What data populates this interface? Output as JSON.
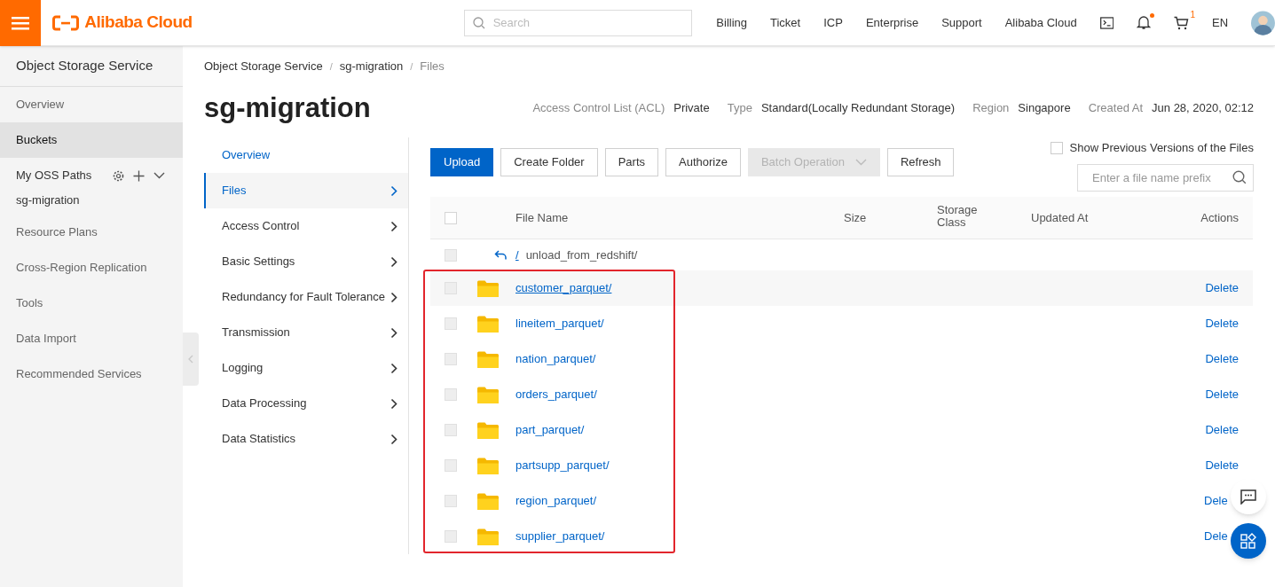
{
  "header": {
    "brand": "Alibaba Cloud",
    "search_placeholder": "Search",
    "nav": [
      "Billing",
      "Ticket",
      "ICP",
      "Enterprise",
      "Support",
      "Alibaba Cloud"
    ],
    "notification_dot": true,
    "cart_count": "1",
    "language": "EN"
  },
  "sidebar": {
    "title": "Object Storage Service",
    "items": [
      {
        "label": "Overview",
        "kind": "link",
        "selected": false
      },
      {
        "label": "Buckets",
        "kind": "link",
        "selected": true
      },
      {
        "label": "My OSS Paths",
        "kind": "section",
        "selected": false
      },
      {
        "label": "sg-migration",
        "kind": "path",
        "selected": false
      },
      {
        "label": "Resource Plans",
        "kind": "link",
        "selected": false
      },
      {
        "label": "Cross-Region Replication",
        "kind": "link",
        "selected": false
      },
      {
        "label": "Tools",
        "kind": "link",
        "selected": false
      },
      {
        "label": "Data Import",
        "kind": "link",
        "selected": false
      },
      {
        "label": "Recommended Services",
        "kind": "link",
        "selected": false
      }
    ]
  },
  "breadcrumb": [
    {
      "label": "Object Storage Service",
      "separator": "/"
    },
    {
      "label": "sg-migration",
      "separator": "/"
    },
    {
      "label": "Files"
    }
  ],
  "bucket": {
    "title": "sg-migration",
    "info": [
      {
        "label": "Access Control List (ACL)",
        "value": "Private"
      },
      {
        "label": "Type",
        "value": "Standard(Locally Redundant Storage)"
      },
      {
        "label": "Region",
        "value": "Singapore"
      },
      {
        "label": "Created At",
        "value": "Jun 28, 2020, 02:12"
      }
    ]
  },
  "bucket_menu": [
    {
      "label": "Overview",
      "kind": "link",
      "selected": false
    },
    {
      "label": "Files",
      "kind": "submenu",
      "selected": true
    },
    {
      "label": "Access Control",
      "kind": "submenu",
      "selected": false
    },
    {
      "label": "Basic Settings",
      "kind": "submenu",
      "selected": false
    },
    {
      "label": "Redundancy for Fault Tolerance",
      "kind": "submenu",
      "selected": false
    },
    {
      "label": "Transmission",
      "kind": "submenu",
      "selected": false
    },
    {
      "label": "Logging",
      "kind": "submenu",
      "selected": false
    },
    {
      "label": "Data Processing",
      "kind": "submenu",
      "selected": false
    },
    {
      "label": "Data Statistics",
      "kind": "submenu",
      "selected": false
    }
  ],
  "toolbar": {
    "buttons": [
      {
        "label": "Upload",
        "kind": "primary",
        "disabled": false
      },
      {
        "label": "Create Folder",
        "kind": "default",
        "disabled": false
      },
      {
        "label": "Parts",
        "kind": "default",
        "disabled": false
      },
      {
        "label": "Authorize",
        "kind": "default",
        "disabled": false
      },
      {
        "label": "Batch Operation",
        "kind": "dropdown",
        "disabled": true
      },
      {
        "label": "Refresh",
        "kind": "default",
        "disabled": false
      }
    ],
    "versions_checkbox": {
      "label": "Show Previous Versions of the Files",
      "checked": false
    },
    "filter": {
      "placeholder": "Enter a file name prefix"
    }
  },
  "table": {
    "select_all_checked": false,
    "columns": [
      "File Name",
      "Size",
      "Storage Class",
      "Updated At",
      "Actions"
    ],
    "parent_row": {
      "checked": false,
      "separator": "/",
      "path": "unload_from_redshift/"
    },
    "rows": [
      {
        "checked": false,
        "name": "customer_parquet/",
        "action": "Delete",
        "hovered": true
      },
      {
        "checked": false,
        "name": "lineitem_parquet/",
        "action": "Delete",
        "hovered": false
      },
      {
        "checked": false,
        "name": "nation_parquet/",
        "action": "Delete",
        "hovered": false
      },
      {
        "checked": false,
        "name": "orders_parquet/",
        "action": "Delete",
        "hovered": false
      },
      {
        "checked": false,
        "name": "part_parquet/",
        "action": "Delete",
        "hovered": false
      },
      {
        "checked": false,
        "name": "partsupp_parquet/",
        "action": "Delete",
        "hovered": false
      },
      {
        "checked": false,
        "name": "region_parquet/",
        "action": "Dele",
        "hovered": false
      },
      {
        "checked": false,
        "name": "supplier_parquet/",
        "action": "Dele",
        "hovered": false
      }
    ]
  }
}
